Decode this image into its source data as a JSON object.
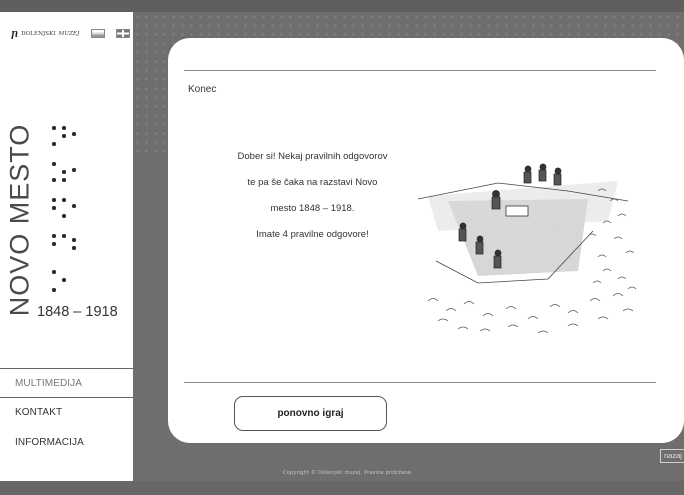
{
  "brand": {
    "logo_text": "DOLENJSKI",
    "logo_text_italic": "MUZEJ",
    "logo_icon": "dolenjski-muzej-logo"
  },
  "languages": [
    {
      "code": "si",
      "icon": "slovenian-flag-icon"
    },
    {
      "code": "en",
      "icon": "english-flag-icon"
    }
  ],
  "sidebar": {
    "title": "NOVO MESTO",
    "years": "1848 – 1918",
    "nav": [
      {
        "label": "MULTIMEDIJA",
        "active": true
      },
      {
        "label": "KONTAKT",
        "active": false
      },
      {
        "label": "INFORMACIJA",
        "active": false
      }
    ]
  },
  "quiz": {
    "heading": "Konec",
    "message_line1": "Dober si! Nekaj pravilnih odgovorov",
    "message_line2": "te pa še čaka na razstavi Novo",
    "message_line3": "mesto 1848 – 1918.",
    "result": "Imate 4 pravilne odgovore!",
    "replay_label": "ponovno igraj",
    "illustration_icon": "crowd-sketch-illustration"
  },
  "footer": {
    "copyright": "Copyright © Dolenjski muzej. Pravice pridržane.",
    "back_label": "nazaj"
  },
  "colors": {
    "background": "#6e6e6e",
    "panel": "#ffffff",
    "text": "#333333"
  }
}
